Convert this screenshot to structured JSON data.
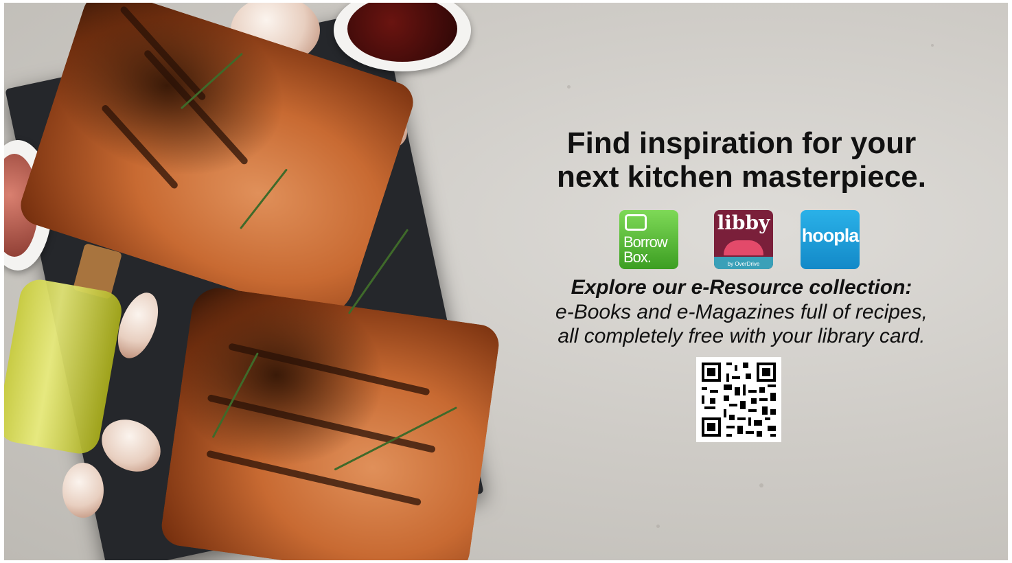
{
  "headline": {
    "line1": "Find inspiration for your",
    "line2": "next kitchen masterpiece."
  },
  "apps": [
    {
      "name": "Borrow Box.",
      "line1": "Borrow",
      "line2": "Box.",
      "color": "#4caf2a",
      "icon": "borrowbox-icon"
    },
    {
      "name": "libby",
      "subtitle": "by OverDrive",
      "color": "#7a1f3a",
      "icon": "libby-icon"
    },
    {
      "name": "hoopla",
      "color": "#1b9dd9",
      "icon": "hoopla-icon"
    }
  ],
  "explore": {
    "heading": "Explore our e-Resource collection:",
    "line1": "e-Books and e-Magazines full of recipes,",
    "line2": "all completely free with your library card."
  },
  "qr": {
    "icon": "qr-code-icon"
  }
}
